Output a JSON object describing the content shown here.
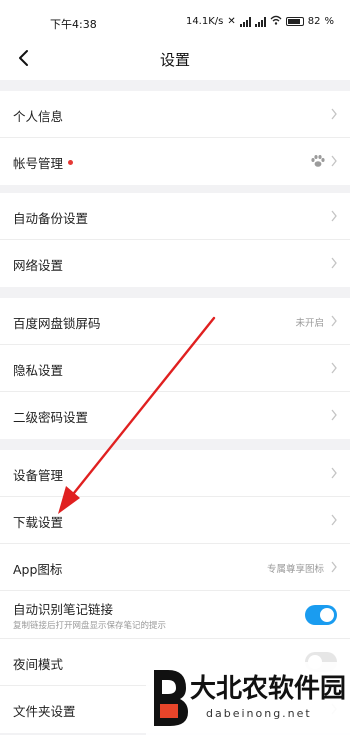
{
  "status_bar": {
    "time": "下午4:38",
    "net_speed": "14.1K/s",
    "battery": "82"
  },
  "nav": {
    "title": "设置"
  },
  "groups": [
    {
      "items": [
        {
          "label": "个人信息"
        },
        {
          "label": "帐号管理",
          "badge_dot": true,
          "icon": "paw-icon"
        }
      ]
    },
    {
      "items": [
        {
          "label": "自动备份设置"
        },
        {
          "label": "网络设置"
        }
      ]
    },
    {
      "items": [
        {
          "label": "百度网盘锁屏码",
          "value": "未开启"
        },
        {
          "label": "隐私设置"
        },
        {
          "label": "二级密码设置"
        }
      ]
    },
    {
      "items": [
        {
          "label": "设备管理"
        },
        {
          "label": "下载设置"
        },
        {
          "label": "App图标",
          "value": "专属尊享图标"
        },
        {
          "label": "自动识别笔记链接",
          "sub": "复制链接后打开网盘显示保存笔记的提示",
          "toggle": "on"
        },
        {
          "label": "夜间模式",
          "toggle": "off"
        },
        {
          "label": "文件夹设置"
        }
      ]
    }
  ],
  "annotation": {
    "arrow_color": "#e02020"
  },
  "watermark": {
    "brand": "大北农软件园",
    "domain": "dabeinong.net"
  }
}
